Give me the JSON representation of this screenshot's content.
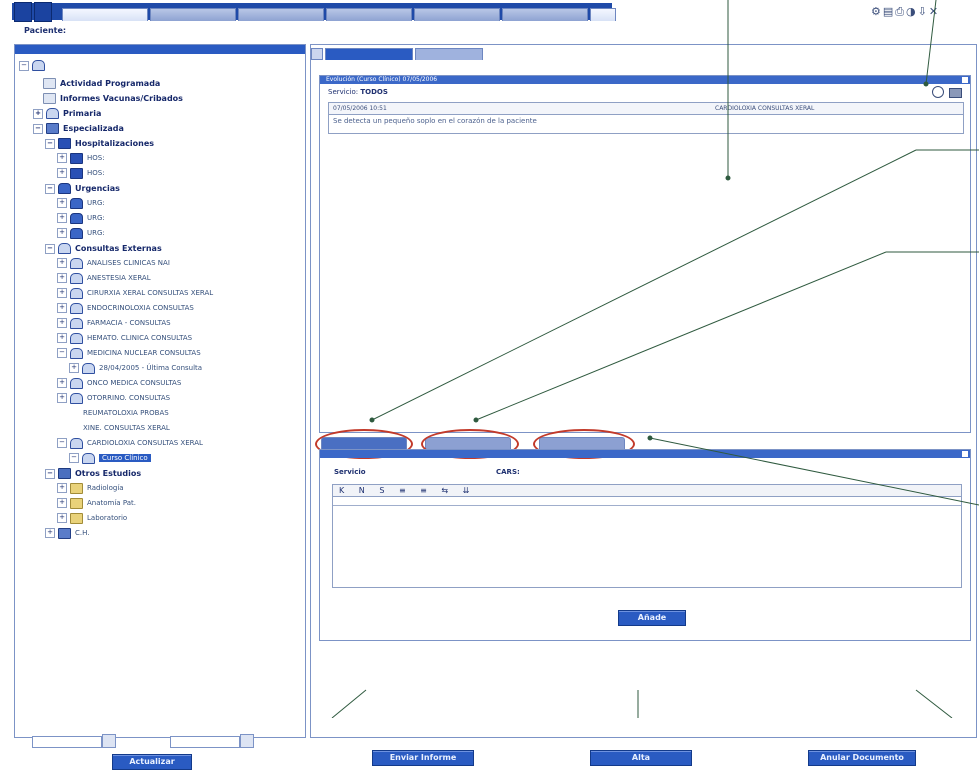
{
  "header": {
    "top_tabs": [
      "",
      "",
      "",
      "",
      "",
      "",
      ""
    ],
    "patient_label": "Paciente:"
  },
  "tree": {
    "nodes": [
      {
        "label": "Actividad Programada",
        "style": "bold"
      },
      {
        "label": "Informes Vacunas/Cribados",
        "style": "bold"
      },
      {
        "label": "Primaria",
        "style": "bold"
      },
      {
        "label": "Especializada",
        "style": "bold"
      },
      {
        "label": "Hospitalizaciones",
        "style": "bold"
      },
      {
        "label": "HOS:",
        "style": "small"
      },
      {
        "label": "HOS:",
        "style": "small"
      },
      {
        "label": "Urgencias",
        "style": "bold"
      },
      {
        "label": "URG:",
        "style": "small"
      },
      {
        "label": "URG:",
        "style": "small"
      },
      {
        "label": "URG:",
        "style": "small"
      },
      {
        "label": "Consultas Externas",
        "style": "bold"
      },
      {
        "label": "ANALISES CLINICAS NAI",
        "style": "small"
      },
      {
        "label": "ANESTESIA XERAL",
        "style": "small"
      },
      {
        "label": "CIRURXIA XERAL CONSULTAS XERAL",
        "style": "small"
      },
      {
        "label": "ENDOCRINOLOXIA CONSULTAS",
        "style": "small"
      },
      {
        "label": "FARMACIA - CONSULTAS",
        "style": "small"
      },
      {
        "label": "HEMATO. CLINICA CONSULTAS",
        "style": "small"
      },
      {
        "label": "MEDICINA NUCLEAR CONSULTAS",
        "style": "small"
      },
      {
        "label": "28/04/2005 - Última Consulta",
        "style": "small"
      },
      {
        "label": "ONCO MEDICA CONSULTAS",
        "style": "small"
      },
      {
        "label": "OTORRINO. CONSULTAS",
        "style": "small"
      },
      {
        "label": "REUMATOLOXIA PROBAS",
        "style": "small"
      },
      {
        "label": "XINE. CONSULTAS XERAL",
        "style": "small"
      },
      {
        "label": "CARDIOLOXIA CONSULTAS XERAL",
        "style": "small"
      },
      {
        "label": "Curso Clínico",
        "style": "sel"
      },
      {
        "label": "Otros Estudios",
        "style": "bold"
      },
      {
        "label": "Radiología",
        "style": "small"
      },
      {
        "label": "Anatomía Pat.",
        "style": "small"
      },
      {
        "label": "Laboratorio",
        "style": "small"
      },
      {
        "label": "C.H.",
        "style": "small"
      }
    ]
  },
  "left_controls": {
    "update_button": "Actualizar"
  },
  "main": {
    "upper_panel": {
      "title": "Evolución (Curso Clínico) 07/05/2006",
      "service_label": "Servicio:",
      "service_value": "TODOS",
      "entry_header_left": "07/05/2006 10:51",
      "entry_header_right": "CARDIOLOXIA CONSULTAS XERAL",
      "entry_text": "Se detecta un pequeño soplo en el corazón de la paciente"
    },
    "lower_panel": {
      "service_label": "Servicio",
      "cars_label": "CARS:",
      "toolbar": "K N S ≡ ≡ ⇆ ⇊",
      "add_button": "Añade"
    }
  },
  "bottom_buttons": {
    "send_report": "Enviar Informe",
    "discharge": "Alta",
    "cancel_document": "Anular Documento"
  }
}
